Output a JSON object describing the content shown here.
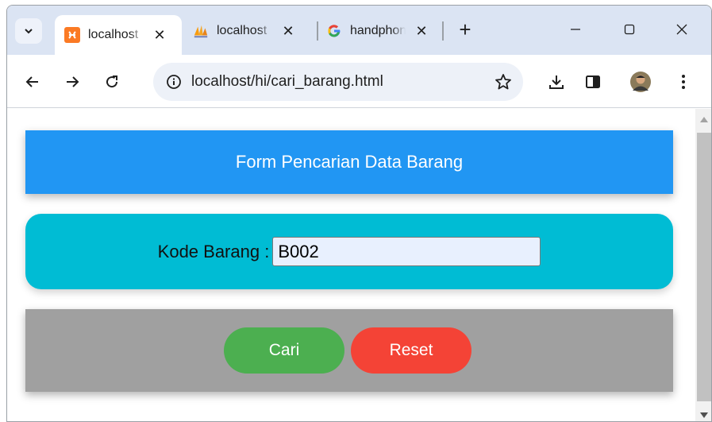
{
  "browser": {
    "tabs": [
      {
        "title": "localhost",
        "favicon": "xampp-icon",
        "active": true
      },
      {
        "title": "localhost",
        "favicon": "phpmyadmin-icon",
        "active": false
      },
      {
        "title": "handphone",
        "favicon": "google-icon",
        "active": false
      }
    ],
    "tab_close_glyph": "✕",
    "new_tab_glyph": "+",
    "address_bar": {
      "url": "localhost/hi/cari_barang.html"
    },
    "colors": {
      "tabstrip": "#dbe4f3",
      "omnibox": "#edf1f8"
    }
  },
  "page": {
    "header_title": "Form Pencarian Data Barang",
    "form": {
      "label": "Kode Barang :",
      "value": "B002"
    },
    "buttons": {
      "search_label": "Cari",
      "reset_label": "Reset"
    },
    "colors": {
      "header": "#2196f3",
      "form_panel": "#00bcd4",
      "button_panel": "#a0a0a0",
      "search_button": "#4caf50",
      "reset_button": "#f44336"
    }
  }
}
